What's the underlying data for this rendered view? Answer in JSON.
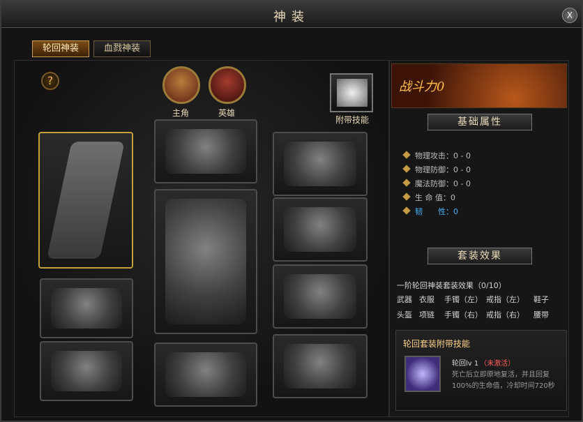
{
  "window": {
    "title": "神装",
    "close_label": "X"
  },
  "tabs": [
    {
      "label": "轮回神装",
      "active": true
    },
    {
      "label": "血戮神装",
      "active": false
    }
  ],
  "left_panel": {
    "help_label": "?",
    "portraits": [
      {
        "label": "主角"
      },
      {
        "label": "英雄"
      }
    ],
    "attached_skill_label": "附带技能",
    "slots": [
      {
        "name": "weapon-slot",
        "selected": true
      },
      {
        "name": "helmet-slot",
        "selected": false
      },
      {
        "name": "necklace-slot",
        "selected": false
      },
      {
        "name": "armor-slot",
        "selected": false
      },
      {
        "name": "boots-slot",
        "selected": false
      },
      {
        "name": "bracelet-left-slot",
        "selected": false
      },
      {
        "name": "bracelet-right-slot",
        "selected": false
      },
      {
        "name": "ring-left-slot",
        "selected": false
      },
      {
        "name": "ring-right-slot",
        "selected": false
      },
      {
        "name": "belt-slot",
        "selected": false
      }
    ]
  },
  "right_panel": {
    "combat_power_label": "战斗力0",
    "base_attrs_title": "基础属性",
    "attrs": [
      {
        "label": "物理攻击：0 - 0",
        "highlight": false
      },
      {
        "label": "物理防御：0 - 0",
        "highlight": false
      },
      {
        "label": "魔法防御：0 - 0",
        "highlight": false
      },
      {
        "label": "生 命 值：0",
        "highlight": false
      },
      {
        "label": "韧　　性：0",
        "highlight": true
      }
    ],
    "set_effect_title": "套装效果",
    "set_effect_header": "一阶轮回神装套装效果（0/10）",
    "set_items_row1": [
      "武器",
      "衣服",
      "手镯（左）",
      "戒指（左）",
      "鞋子"
    ],
    "set_items_row2": [
      "头盔",
      "项链",
      "手镯（右）",
      "戒指（右）",
      "腰带"
    ],
    "set_skill": {
      "title": "轮回套装附带技能",
      "name": "轮回lv 1",
      "status": "（未激活）",
      "description": "死亡后立即原地复活，并且回复100%的生命值，冷却时间720秒"
    }
  },
  "colors": {
    "gold": "#c5a03b",
    "highlight_blue": "#45b2ff",
    "warning_red": "#ff5c5c",
    "tab_active": "#7a4c17"
  }
}
